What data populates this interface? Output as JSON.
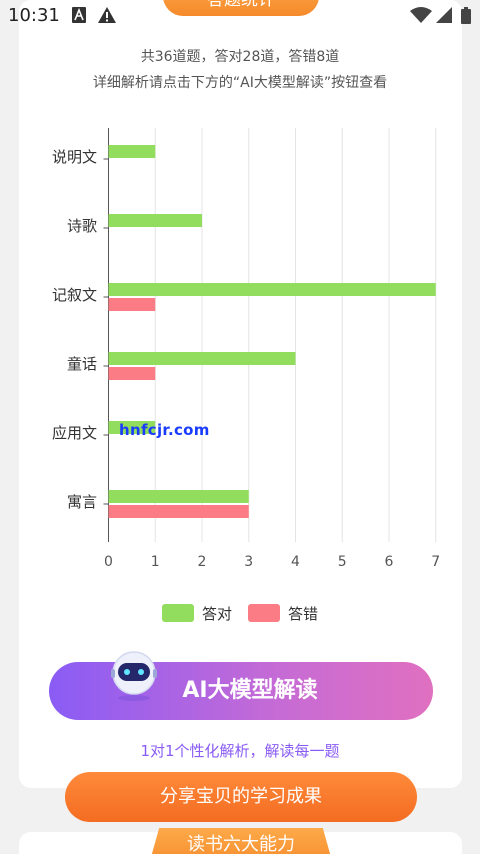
{
  "status_bar": {
    "time": "10:31"
  },
  "header": {
    "tab_label": "答题统计"
  },
  "summary": {
    "line1": "共36道题，答对28道，答错8道",
    "line2": "详细解析请点击下方的“AI大模型解读”按钮查看"
  },
  "chart_data": {
    "type": "bar",
    "orientation": "horizontal",
    "categories": [
      "说明文",
      "诗歌",
      "记叙文",
      "童话",
      "应用文",
      "寓言"
    ],
    "series": [
      {
        "name": "答对",
        "color": "#92dd5d",
        "values": [
          1,
          2,
          7,
          4,
          1,
          3
        ]
      },
      {
        "name": "答错",
        "color": "#fb7c84",
        "values": [
          0,
          0,
          1,
          1,
          0,
          3
        ]
      }
    ],
    "xlim": [
      0,
      7
    ],
    "xticks": [
      "0",
      "1",
      "2",
      "3",
      "4",
      "5",
      "6",
      "7"
    ],
    "grid": true,
    "legend": "bottom"
  },
  "ai_button": {
    "label": "AI大模型解读",
    "subtitle": "1对1个性化解析，解读每一题"
  },
  "share_button": {
    "label": "分享宝贝的学习成果"
  },
  "next_section": {
    "tab_label": "读书六大能力"
  },
  "watermark": "hnfcjr.com"
}
